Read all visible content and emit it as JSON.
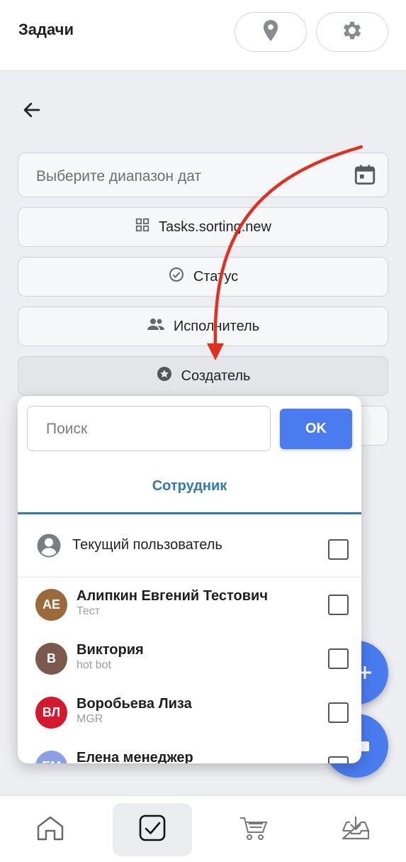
{
  "header": {
    "title": "Задачи",
    "location_icon": "location-pin-icon",
    "settings_icon": "gear-icon"
  },
  "back_icon": "arrow-left-icon",
  "date_range": {
    "placeholder": "Выберите диапазон дат",
    "icon": "calendar-icon"
  },
  "filters": [
    {
      "label": "Tasks.sorting.new",
      "icon": "grid-icon"
    },
    {
      "label": "Статус",
      "icon": "check-circle-icon"
    },
    {
      "label": "Исполнитель",
      "icon": "people-icon"
    },
    {
      "label": "Создатель",
      "icon": "star-circle-icon"
    }
  ],
  "dropdown": {
    "search_placeholder": "Поиск",
    "ok_label": "OK",
    "tab_label": "Сотрудник",
    "current_user": {
      "label": "Текущий пользователь",
      "checked": false
    },
    "people": [
      {
        "initials": "АЕ",
        "name": "Алипкин Евгений Тестович",
        "subtitle": "Тест",
        "color": "#9a6a3a",
        "checked": false
      },
      {
        "initials": "В",
        "name": "Виктория",
        "subtitle": "hot bot",
        "color": "#7b5a4e",
        "checked": false
      },
      {
        "initials": "ВЛ",
        "name": "Воробьева Лиза",
        "subtitle": "MGR",
        "color": "#d4192e",
        "checked": false
      },
      {
        "initials": "ЕМ",
        "name": "Елена менеджер",
        "subtitle": "",
        "color": "#8aa0e6",
        "checked": false
      }
    ]
  },
  "bottom_nav": [
    {
      "icon": "home-icon",
      "active": false
    },
    {
      "icon": "tasks-check-icon",
      "active": true
    },
    {
      "icon": "cart-icon",
      "active": false
    },
    {
      "icon": "inbox-download-icon",
      "active": false
    }
  ],
  "colors": {
    "accent": "#4a7cf0",
    "tab": "#2e79b8",
    "annotation_arrow": "#e0301e"
  }
}
